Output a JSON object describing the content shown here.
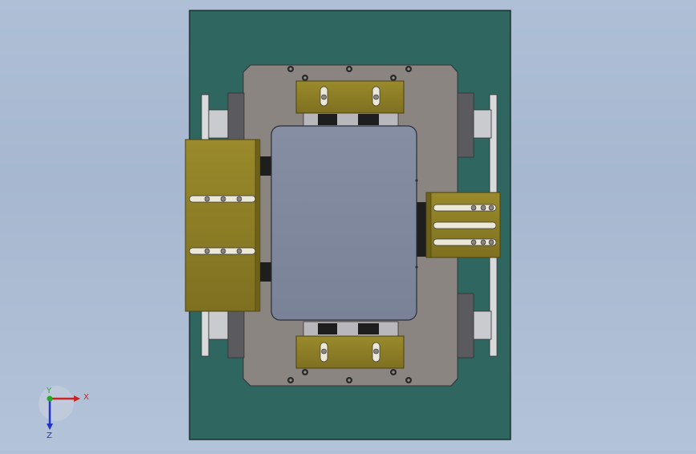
{
  "viewport": {
    "background_top": "#aebfd6",
    "background_bottom": "#b3c3d9"
  },
  "model": {
    "base_plate_color": "#2f6660",
    "mount_plate_color": "#8a8580",
    "center_block_color": "#7e869c",
    "clamp_color": "#8a7b25",
    "clamp_edge_color": "#4a420f"
  },
  "triad": {
    "x_label": "X",
    "y_label": "Y",
    "z_label": "Z",
    "x_color": "#cc2222",
    "y_color": "#22aa22",
    "z_color": "#2233cc"
  }
}
